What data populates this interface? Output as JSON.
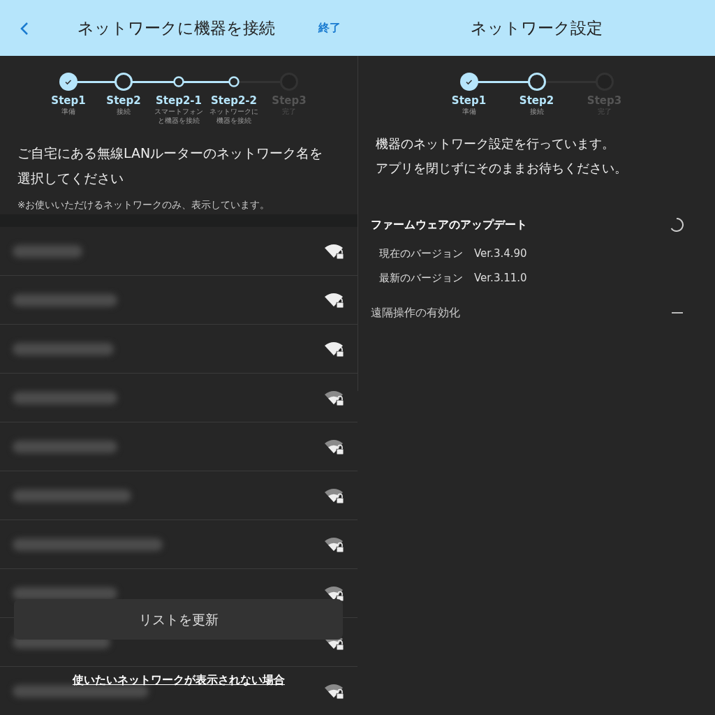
{
  "left_screen": {
    "header": {
      "title": "ネットワークに機器を接続",
      "action": "終了"
    },
    "steps": [
      {
        "label": "Step1",
        "caption": "準備",
        "kind": "done"
      },
      {
        "label": "Step2",
        "caption": "接続",
        "kind": "current"
      },
      {
        "label": "Step2-1",
        "caption": "スマートフォンと機器を接続",
        "kind": "sub"
      },
      {
        "label": "Step2-2",
        "caption": "ネットワークに機器を接続",
        "kind": "sub"
      },
      {
        "label": "Step3",
        "caption": "完了",
        "kind": "pending"
      }
    ],
    "instruction": "ご自宅にある無線LANルーターのネットワーク名を選択してください",
    "note": "※お使いいただけるネットワークのみ、表示しています。",
    "networks": [
      {
        "kind": "full"
      },
      {
        "kind": "full"
      },
      {
        "kind": "full"
      },
      {
        "kind": "partial"
      },
      {
        "kind": "partial"
      },
      {
        "kind": "partial"
      },
      {
        "kind": "partial"
      },
      {
        "kind": "partial"
      },
      {
        "kind": "partial"
      },
      {
        "kind": "partial"
      }
    ],
    "refresh_button": "リストを更新",
    "help_link": "使いたいネットワークが表示されない場合"
  },
  "right_screen": {
    "header": {
      "title": "ネットワーク設定"
    },
    "steps": [
      {
        "label": "Step1",
        "caption": "準備",
        "kind": "done"
      },
      {
        "label": "Step2",
        "caption": "接続",
        "kind": "current"
      },
      {
        "label": "Step3",
        "caption": "完了",
        "kind": "pending"
      }
    ],
    "message_lines": [
      "機器のネットワーク設定を行っています。",
      "アプリを閉じずにそのままお待ちください。"
    ],
    "firmware": {
      "title": "ファームウェアのアップデート",
      "rows": [
        {
          "label": "現在のバージョン",
          "value": "Ver.3.4.90"
        },
        {
          "label": "最新のバージョン",
          "value": "Ver.3.11.0"
        }
      ]
    },
    "remote": {
      "label": "遠隔操作の有効化"
    }
  }
}
